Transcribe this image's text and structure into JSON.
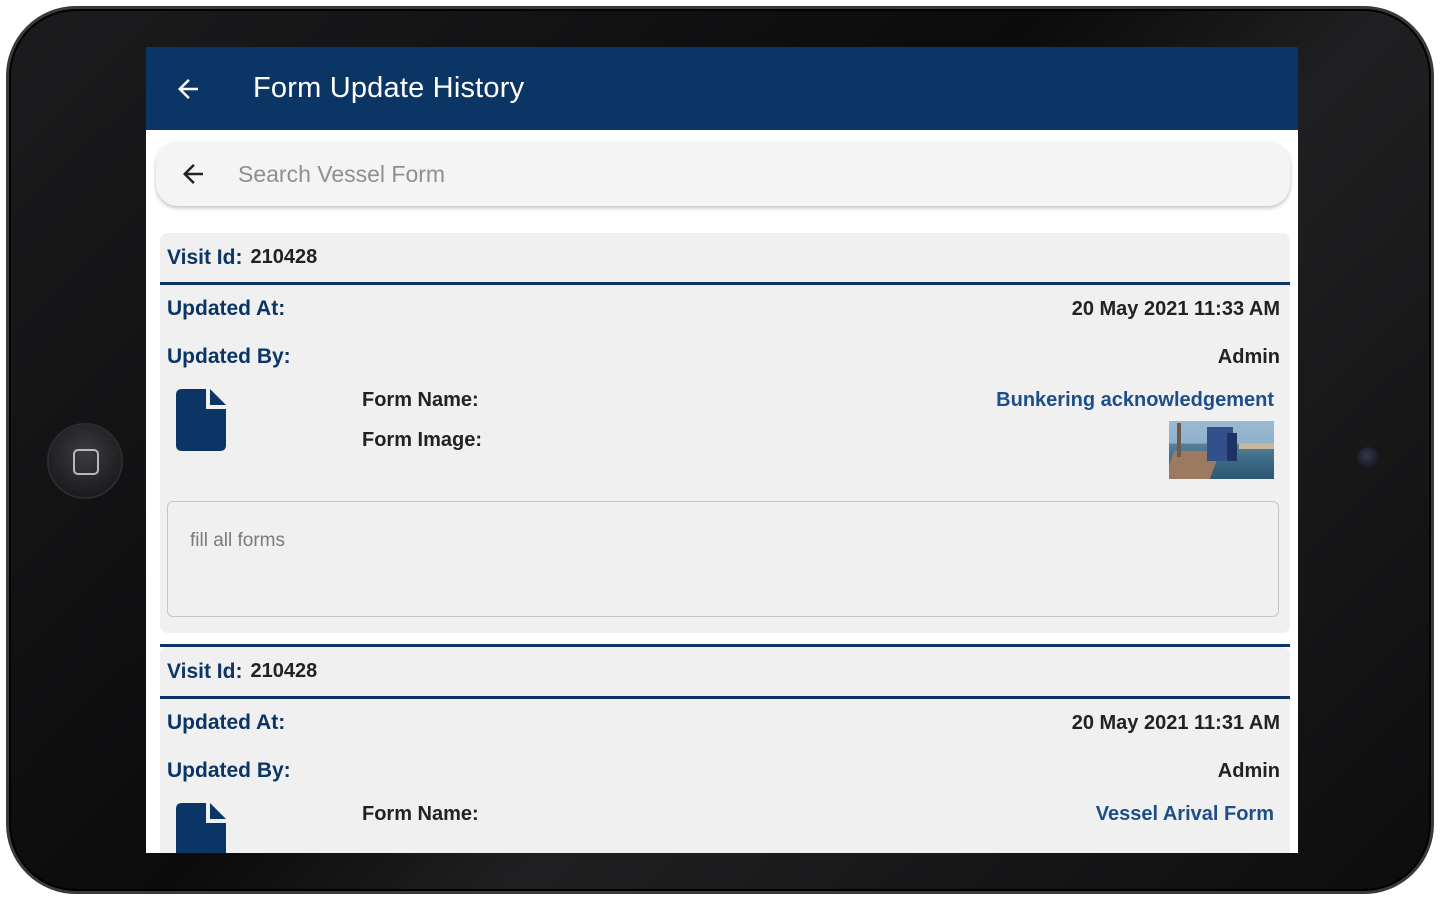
{
  "header": {
    "title": "Form Update History"
  },
  "search": {
    "placeholder": "Search Vessel Form"
  },
  "labels": {
    "visit_id": "Visit Id:",
    "updated_at": "Updated At:",
    "updated_by": "Updated By:",
    "form_name": "Form Name:",
    "form_image": "Form Image:"
  },
  "records": [
    {
      "visit_id": "210428",
      "updated_at": "20 May 2021 11:33 AM",
      "updated_by": "Admin",
      "form_name": "Bunkering acknowledgement",
      "remarks": "fill all forms"
    },
    {
      "visit_id": "210428",
      "updated_at": "20 May 2021 11:31 AM",
      "updated_by": "Admin",
      "form_name": "Vessel Arival Form"
    }
  ],
  "colors": {
    "primary": "#0b3565",
    "link": "#1d4e89",
    "card_bg": "#f0f0f0"
  },
  "icons": [
    "arrow-back-icon",
    "document-icon"
  ]
}
